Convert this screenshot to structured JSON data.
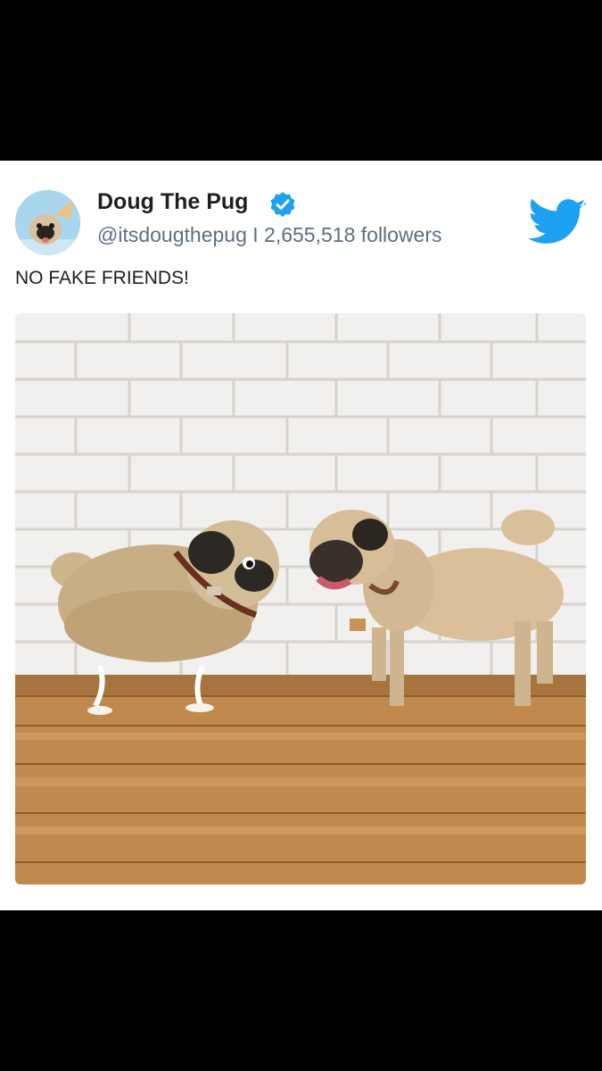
{
  "tweet": {
    "display_name": "Doug The Pug",
    "handle": "@itsdougthepug",
    "separator": "I",
    "followers": "2,655,518 followers",
    "text": "NO FAKE FRIENDS!",
    "verified": true
  },
  "icons": {
    "verified": "verified-badge-icon",
    "brand": "twitter-bird-icon"
  },
  "colors": {
    "background": "#000000",
    "card": "#ffffff",
    "verified_blue": "#1da1f2",
    "twitter_blue": "#1da1f2",
    "name_text": "#1c2022",
    "secondary_text": "#5b7083"
  }
}
